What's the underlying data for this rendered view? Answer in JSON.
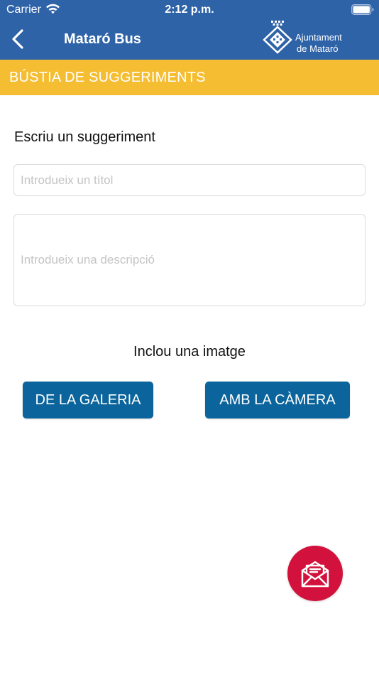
{
  "status_bar": {
    "carrier": "Carrier",
    "time": "2:12 p.m."
  },
  "nav": {
    "title": "Mataró Bus",
    "back_icon": "chevron-left-icon",
    "logo": {
      "line1": "Ajuntament",
      "line2": "de Mataró"
    }
  },
  "section": {
    "title": "BÚSTIA DE SUGGERIMENTS"
  },
  "form": {
    "heading": "Escriu un suggeriment",
    "title_field": {
      "placeholder": "Introdueix un títol",
      "value": ""
    },
    "description_field": {
      "placeholder": "Introdueix una descripció",
      "value": ""
    },
    "image_heading": "Inclou una imatge",
    "gallery_button": "DE LA GALERIA",
    "camera_button": "AMB LA CÀMERA"
  },
  "fab": {
    "icon": "mail-open-icon"
  },
  "colors": {
    "header": "#2f63a8",
    "section_bar": "#f5be32",
    "button": "#0b649c",
    "fab": "#d2123c"
  }
}
